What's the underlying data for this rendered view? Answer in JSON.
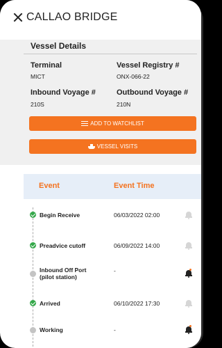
{
  "header": {
    "title": "CALLAO BRIDGE"
  },
  "details": {
    "title": "Vessel Details",
    "terminal_label": "Terminal",
    "terminal_value": "MICT",
    "registry_label": "Vessel Registry #",
    "registry_value": "ONX-066-22",
    "inbound_label": "Inbound Voyage #",
    "inbound_value": "210S",
    "outbound_label": "Outbound Voyage #",
    "outbound_value": "210N",
    "watchlist_button": "ADD TO WATCHLIST",
    "visits_button": "VESSEL VISITS"
  },
  "events": {
    "col_event": "Event",
    "col_time": "Event Time",
    "rows": [
      {
        "name": "Begin Receive",
        "time": "06/03/2022 02:00",
        "status": "done",
        "notify": "off"
      },
      {
        "name": "Preadvice cutoff",
        "time": "06/09/2022 14:00",
        "status": "done",
        "notify": "off"
      },
      {
        "name_line1": "Inbound Off Port",
        "name_line2": "(pilot station)",
        "time": "-",
        "status": "pending",
        "notify": "on"
      },
      {
        "name": "Arrived",
        "time": "06/10/2022 17:30",
        "status": "done",
        "notify": "off"
      },
      {
        "name": "Working",
        "time": "-",
        "status": "pending",
        "notify": "on"
      }
    ]
  },
  "colors": {
    "accent": "#f47320",
    "done": "#35a84a",
    "pending": "#c4c4c4",
    "header_bg": "#e6eef8"
  },
  "icons": [
    "close-icon",
    "list-icon",
    "ship-icon",
    "check-icon",
    "bell-icon"
  ]
}
